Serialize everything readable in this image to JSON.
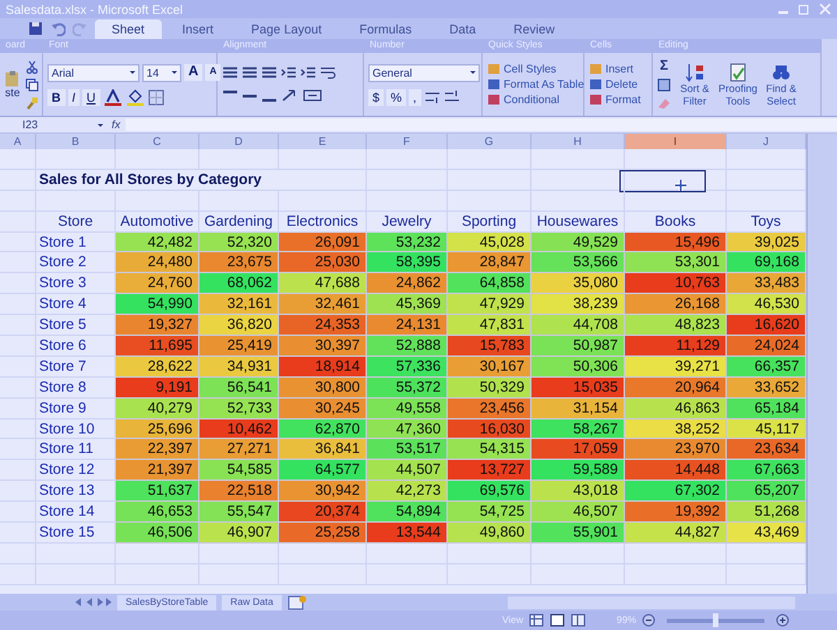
{
  "window": {
    "title": "Salesdata.xlsx - Microsoft Excel"
  },
  "ribbon_tabs": [
    {
      "label": "Sheet",
      "selected": true
    },
    {
      "label": "Insert",
      "selected": false
    },
    {
      "label": "Page Layout",
      "selected": false
    },
    {
      "label": "Formulas",
      "selected": false
    },
    {
      "label": "Data",
      "selected": false
    },
    {
      "label": "Review",
      "selected": false
    }
  ],
  "ribbon_groups": [
    {
      "kind": "clipboard",
      "label": "oard",
      "paste": "ste"
    },
    {
      "kind": "font",
      "label": "Font",
      "font": "Arial",
      "size": "14",
      "grow": [
        "A",
        "A"
      ],
      "styles": [
        "B",
        "I",
        "U"
      ]
    },
    {
      "kind": "alignment",
      "label": "Alignment"
    },
    {
      "kind": "number",
      "label": "Number",
      "format": "General",
      "symbols": [
        "$",
        "%",
        ","
      ]
    },
    {
      "kind": "styles",
      "label": "Quick Styles",
      "items": [
        "Cell Styles",
        "Format As Table",
        "Conditional"
      ]
    },
    {
      "kind": "cells",
      "label": "Cells",
      "items": [
        "Insert",
        "Delete",
        "Format"
      ]
    },
    {
      "kind": "editing",
      "label": "Editing",
      "sum": "Σ",
      "items": [
        "Sort & Filter",
        "Proofing Tools",
        "Find & Select"
      ]
    }
  ],
  "formula_bar": {
    "name_box": "I23",
    "fx": "fx"
  },
  "columns": [
    {
      "label": "A",
      "selected": false
    },
    {
      "label": "B",
      "selected": false
    },
    {
      "label": "C",
      "selected": false
    },
    {
      "label": "D",
      "selected": false
    },
    {
      "label": "E",
      "selected": false
    },
    {
      "label": "F",
      "selected": false
    },
    {
      "label": "G",
      "selected": false
    },
    {
      "label": "H",
      "selected": false
    },
    {
      "label": "I",
      "selected": true
    },
    {
      "label": "J",
      "selected": false
    }
  ],
  "sheet": {
    "title": "Sales for All Stores by Category",
    "header": [
      "Store",
      "Automotive",
      "Gardening",
      "Electronics",
      "Jewelry",
      "Sporting",
      "Housewares",
      "Books",
      "Toys"
    ],
    "rows": [
      {
        "store": "Store 1",
        "values": [
          "42,482",
          "52,320",
          "26,091",
          "53,232",
          "45,028",
          "49,529",
          "15,496",
          "39,025"
        ]
      },
      {
        "store": "Store 2",
        "values": [
          "24,480",
          "23,675",
          "25,030",
          "58,395",
          "28,847",
          "53,566",
          "53,301",
          "69,168"
        ]
      },
      {
        "store": "Store 3",
        "values": [
          "24,760",
          "68,062",
          "47,688",
          "24,862",
          "64,858",
          "35,080",
          "10,763",
          "33,483"
        ]
      },
      {
        "store": "Store 4",
        "values": [
          "54,990",
          "32,161",
          "32,461",
          "45,369",
          "47,929",
          "38,239",
          "26,168",
          "46,530"
        ]
      },
      {
        "store": "Store 5",
        "values": [
          "19,327",
          "36,820",
          "24,353",
          "24,131",
          "47,831",
          "44,708",
          "48,823",
          "16,620"
        ]
      },
      {
        "store": "Store 6",
        "values": [
          "11,695",
          "25,419",
          "30,397",
          "52,888",
          "15,783",
          "50,987",
          "11,129",
          "24,024"
        ]
      },
      {
        "store": "Store 7",
        "values": [
          "28,622",
          "34,931",
          "18,914",
          "57,336",
          "30,167",
          "50,306",
          "39,271",
          "66,357"
        ]
      },
      {
        "store": "Store 8",
        "values": [
          "9,191",
          "56,541",
          "30,800",
          "55,372",
          "50,329",
          "15,035",
          "20,964",
          "33,652"
        ]
      },
      {
        "store": "Store 9",
        "values": [
          "40,279",
          "52,733",
          "30,245",
          "49,558",
          "23,456",
          "31,154",
          "46,863",
          "65,184"
        ]
      },
      {
        "store": "Store 10",
        "values": [
          "25,696",
          "10,462",
          "62,870",
          "47,360",
          "16,030",
          "58,267",
          "38,252",
          "45,117"
        ]
      },
      {
        "store": "Store 11",
        "values": [
          "22,397",
          "27,271",
          "36,841",
          "53,517",
          "54,315",
          "17,059",
          "23,970",
          "23,634"
        ]
      },
      {
        "store": "Store 12",
        "values": [
          "21,397",
          "54,585",
          "64,577",
          "44,507",
          "13,727",
          "59,589",
          "14,448",
          "67,663"
        ]
      },
      {
        "store": "Store 13",
        "values": [
          "51,637",
          "22,518",
          "30,942",
          "42,273",
          "69,576",
          "43,018",
          "67,302",
          "65,207"
        ]
      },
      {
        "store": "Store 14",
        "values": [
          "46,653",
          "55,547",
          "20,374",
          "54,894",
          "54,725",
          "46,507",
          "19,392",
          "51,268"
        ]
      },
      {
        "store": "Store 15",
        "values": [
          "46,506",
          "46,907",
          "25,258",
          "13,544",
          "49,860",
          "55,901",
          "44,827",
          "43,469"
        ]
      }
    ]
  },
  "sheet_tabs": [
    {
      "label": "SalesByStoreTable"
    },
    {
      "label": "Raw Data"
    }
  ],
  "status_bar": {
    "view": "View",
    "zoom": "99%",
    "zoom_slider": {
      "level": 0.5
    }
  }
}
